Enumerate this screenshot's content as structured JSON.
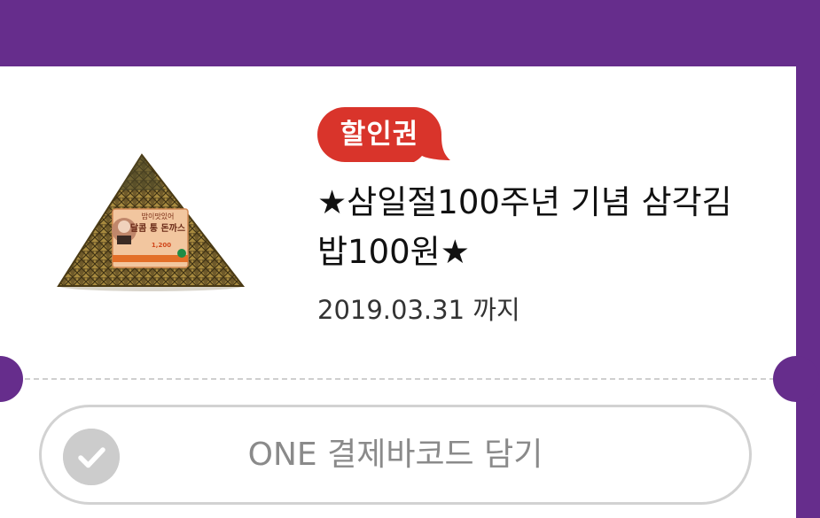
{
  "colors": {
    "background": "#662d8c",
    "card": "#ffffff",
    "badge": "#d9342b",
    "title": "#111111",
    "expiry": "#333333",
    "button_border": "#d2d2d2",
    "button_text": "#8a8a8a",
    "check_circle": "#cccccc"
  },
  "coupon": {
    "badge_label": "할인권",
    "title": "★삼일절100주년 기념 삼각김밥100원★",
    "expiry": "2019.03.31 까지",
    "product_image": {
      "icon": "triangle-gimbap-product-image",
      "package_label": "달콤 통 돈까스",
      "price_text": "1,200"
    }
  },
  "barcode_button": {
    "label": "ONE 결제바코드 담기",
    "check_icon": "check-circle-icon"
  }
}
